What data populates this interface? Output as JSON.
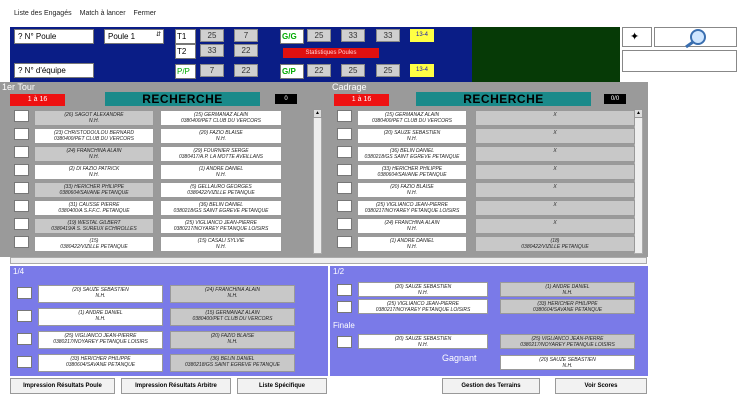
{
  "menu": {
    "items": [
      "Liste des Engagés",
      "Match à lancer",
      "Fermer"
    ]
  },
  "header": {
    "poule_label": "? N° Poule",
    "poule_select": "Poule 1",
    "equipe_label": "? N° d'équipe",
    "t1": "T1",
    "t1_a": "25",
    "t1_b": "7",
    "t2": "T2",
    "t2_a": "33",
    "t2_b": "22",
    "pp": "P/P",
    "pp_a": "7",
    "pp_b": "22",
    "gg": "G/G",
    "gg_a": "25",
    "gg_b": "33",
    "gg_c": "33",
    "gg_tag": "13-4",
    "gp": "G/P",
    "gp_a": "22",
    "gp_b": "25",
    "gp_c": "25",
    "gp_tag": "13-4",
    "stats": "Statistiques Poules"
  },
  "tour1": {
    "title": "1er Tour",
    "range": "1 à 16",
    "search": "RECHERCHE",
    "count": "0",
    "left": [
      [
        "(26) SAGOT ALEXANDRE",
        "N.H."
      ],
      [
        "(23) CHRISTODOULOU BERNARD",
        "0380400/PET CLUB DU VERCORS"
      ],
      [
        "(24) FRANCHINA ALAIN",
        "N.H."
      ],
      [
        "(2) DI FAZIO PATRICK",
        "N.H."
      ],
      [
        "(33) HERICHER PHILIPPE",
        "0380604/SAVANE PETANQUE"
      ],
      [
        "(31) CAUSSE PIERRE",
        "0380400/A S.F.F.C. PETANQUE"
      ],
      [
        "(19) WESTAL GILBERT",
        "0380419/A S. SUREUX ECHIROLLES"
      ],
      [
        "(15)",
        "0380422/VIZILLE PETANQUE"
      ]
    ],
    "right": [
      [
        "(15) GERMANAZ ALAIN",
        "0380400/PET CLUB DU VERCORS"
      ],
      [
        "(20) FAZIO BLAISE",
        "N.H."
      ],
      [
        "(29) FOURNIER SERGE",
        "0380417/A.P. LA MOTTE AVEILLANS"
      ],
      [
        "(1) ANDRE DANIEL",
        "N.H."
      ],
      [
        "(5) GELLAURO GEORGES",
        "0380422/VIZILLE PETANQUE"
      ],
      [
        "(36) BELIN DANIEL",
        "0380218/GS SAINT EGREVE PETANQUE"
      ],
      [
        "(25) VIGLIANCO JEAN-PIERRE",
        "0380217/NOYAREY PETANQUE LOISIRS"
      ],
      [
        "(15) CASALI SYLVIE",
        "N.H."
      ]
    ]
  },
  "cadrage": {
    "title": "Cadrage",
    "range": "1 à 16",
    "search": "RECHERCHE",
    "count": "0/0",
    "left": [
      [
        "(15) GERMANAZ ALAIN",
        "0380400/PET CLUB DU VERCORS"
      ],
      [
        "(20) SAUZE SEBASTIEN",
        "N.H."
      ],
      [
        "(36) BELIN DANIEL",
        "0380218/GS SAINT EGREVE PETANQUE"
      ],
      [
        "(33) HERICHER PHILIPPE",
        "0380604/SAVANE PETANQUE"
      ],
      [
        "(20) FAZIO BLAISE",
        "N.H."
      ],
      [
        "(25) VIGLIANCO JEAN-PIERRE",
        "0380217/NOYAREY PETANQUE LOISIRS"
      ],
      [
        "(24) FRANCHINA ALAIN",
        "N.H."
      ],
      [
        "(1) ANDRE DANIEL",
        "N.H."
      ]
    ],
    "right": [
      [
        "X",
        ""
      ],
      [
        "X",
        ""
      ],
      [
        "X",
        ""
      ],
      [
        "X",
        ""
      ],
      [
        "X",
        ""
      ],
      [
        "X",
        ""
      ],
      [
        "X",
        ""
      ],
      [
        "(18)",
        "0380422/VIZILLE PETANQUE"
      ]
    ]
  },
  "quart": {
    "title": "1/4",
    "left": [
      [
        "(20) SAUZE SEBASTIEN",
        "N.H."
      ],
      [
        "(1) ANDRE DANIEL",
        "N.H."
      ],
      [
        "(25) VIGLIANCO JEAN-PIERRE",
        "0380217/NOYAREY PETANQUE LOISIRS"
      ],
      [
        "(33) HERICHER PHILIPPE",
        "0380604/SAVANE PETANQUE"
      ]
    ],
    "right": [
      [
        "(24) FRANCHINA ALAIN",
        "N.H."
      ],
      [
        "(15) GERMANAZ ALAIN",
        "0380400/PET CLUB DU VERCORS"
      ],
      [
        "(20) FAZIO BLAISE",
        "N.H."
      ],
      [
        "(36) BELIN DANIEL",
        "0380218/GS SAINT EGREVE PETANQUE"
      ]
    ]
  },
  "demi": {
    "title": "1/2",
    "left": [
      [
        "(20) SAUZE SEBASTIEN",
        "N.H."
      ],
      [
        "(25) VIGLIANCO JEAN-PIERRE",
        "0380217/NOYAREY PETANQUE LOISIRS"
      ]
    ],
    "right": [
      [
        "(1) ANDRE DANIEL",
        "N.H."
      ],
      [
        "(33) HERICHER PHILIPPE",
        "0380604/SAVANE PETANQUE"
      ]
    ]
  },
  "finale": {
    "title": "Finale",
    "left": [
      "(20) SAUZE SEBASTIEN",
      "N.H."
    ],
    "right": [
      "(25) VIGLIANCO JEAN-PIERRE",
      "0380217/NOYAREY PETANQUE LOISIRS"
    ],
    "winner_label": "Gagnant",
    "winner": [
      "(20) SAUZE SEBASTIEN",
      "N.H."
    ]
  },
  "buttons": {
    "print_poule": "Impression Résultats Poule",
    "print_arbre": "Impression Résultats Arbitre",
    "liste": "Liste Spécifique",
    "terrains": "Gestion des Terrains",
    "scores": "Voir Scores"
  }
}
